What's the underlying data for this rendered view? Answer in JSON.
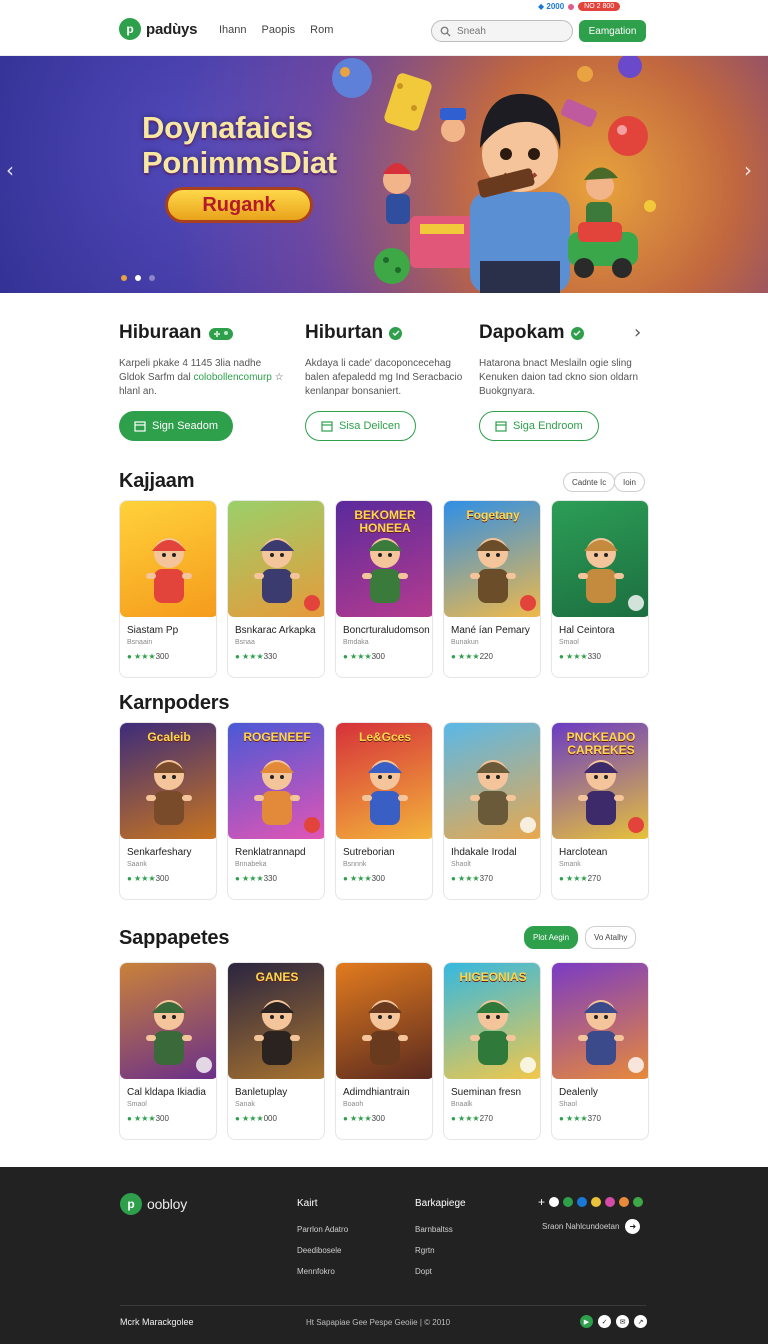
{
  "header": {
    "logo_mark": "p",
    "logo_text": "padùys",
    "nav": [
      "Ihann",
      "Paopis",
      "Rom"
    ],
    "search_placeholder": "Sneah",
    "cta": "Eamgation",
    "coin": "◆ 2000",
    "badge": "NO 2 800"
  },
  "hero": {
    "title_line1": "Doynafaicis",
    "title_line2": "PonimmsDiat",
    "cta": "Rugank",
    "prev": "‹",
    "next": "›"
  },
  "features": [
    {
      "title": "Hiburaan",
      "text_a": "Karpeli pkake 4 1145 3lia nadhe Gldok Sarfm dal ",
      "text_hl": "colobollencomurp",
      "text_b": " ☆ hlanl an.",
      "button": "Sign Seadom"
    },
    {
      "title": "Hiburtan",
      "text_a": "Akdaya li cade' dacoponcecehag balen afepaledd mg Ind Seracbacio kenlanpar bonsaniert.",
      "text_hl": "",
      "text_b": "",
      "button": "Sisa Deilcen"
    },
    {
      "title": "Dapokam",
      "text_a": "Hatarona bnact Meslailn ogie sling Kenuken daion tad ckno sion oldarn Buokgnyara.",
      "text_hl": "",
      "text_b": "",
      "button": "Siga Endroom"
    }
  ],
  "sections": [
    {
      "title": "Kajjaam",
      "chips": [
        "Cadnte Ic",
        "Ioin"
      ],
      "cards": [
        {
          "title": "Siastam Pp",
          "sub": "Bsnaain",
          "rating": "300",
          "overlay": "",
          "c1": "#ffd23a",
          "c2": "#f59b1c",
          "fig": "#e2443b",
          "corner": "none"
        },
        {
          "title": "Bsnkarac Arkapka",
          "sub": "Bsnaa",
          "rating": "330",
          "overlay": "",
          "c1": "#9ad06a",
          "c2": "#e79a3a",
          "fig": "#3b3b6f",
          "corner": "red"
        },
        {
          "title": "Boncrturaludomson",
          "sub": "Bmdaka",
          "rating": "300",
          "overlay": "BEKOMER HONEEA",
          "c1": "#5a2a9c",
          "c2": "#b53b8f",
          "fig": "#3a7a3a",
          "corner": "none"
        },
        {
          "title": "Mané ían Pemary",
          "sub": "Bunakun",
          "rating": "220",
          "overlay": "Fogetany",
          "c1": "#2f8fe6",
          "c2": "#f0b94a",
          "fig": "#6b4d2a",
          "corner": "red"
        },
        {
          "title": "Hal Ceintora",
          "sub": "Smaol",
          "rating": "330",
          "overlay": "",
          "c1": "#2c9e57",
          "c2": "#1c6e3f",
          "fig": "#c48a3e",
          "corner": "white"
        }
      ]
    },
    {
      "title": "Karnpoders",
      "chips": [],
      "cards": [
        {
          "title": "Senkarfeshary",
          "sub": "Saank",
          "rating": "300",
          "overlay": "Gcaleib",
          "c1": "#3d2c7a",
          "c2": "#c9751f",
          "fig": "#7a4b2a",
          "corner": "none"
        },
        {
          "title": "Renklatrannapd",
          "sub": "Bnnabeka",
          "rating": "330",
          "overlay": "ROGENEEF",
          "c1": "#4a58d6",
          "c2": "#e255b5",
          "fig": "#e28a3a",
          "corner": "red"
        },
        {
          "title": "Sutreborian",
          "sub": "Bsnnnk",
          "rating": "300",
          "overlay": "Le&Gces",
          "c1": "#d6313a",
          "c2": "#f3b43b",
          "fig": "#3a5fc4",
          "corner": "none"
        },
        {
          "title": "Ihdakale Irodal",
          "sub": "Shaolt",
          "rating": "370",
          "overlay": "",
          "c1": "#5ab8e8",
          "c2": "#e9a84d",
          "fig": "#6b5a3a",
          "corner": "white"
        },
        {
          "title": "Harclotean",
          "sub": "Smank",
          "rating": "270",
          "overlay": "PNCKEADO CARREKES",
          "c1": "#6a3bc4",
          "c2": "#e8c23a",
          "fig": "#3c2a6a",
          "corner": "red"
        }
      ]
    },
    {
      "title": "Sappapetes",
      "chips": [
        "Plot Aegin",
        "Vo Atalhy"
      ],
      "cards": [
        {
          "title": "Cal kldapa Ikiadia",
          "sub": "Smaol",
          "rating": "300",
          "overlay": "",
          "c1": "#c9823a",
          "c2": "#6a2f8a",
          "fig": "#3a6a3a",
          "corner": "white"
        },
        {
          "title": "Banletuplay",
          "sub": "Sanak",
          "rating": "000",
          "overlay": "GANES",
          "c1": "#2a2540",
          "c2": "#a8732f",
          "fig": "#2b2320",
          "corner": "none"
        },
        {
          "title": "Adimdhiantrain",
          "sub": "Boaoh",
          "rating": "300",
          "overlay": "",
          "c1": "#e27b1f",
          "c2": "#5a2a1f",
          "fig": "#6a3a1f",
          "corner": "none"
        },
        {
          "title": "Sueminan fresn",
          "sub": "Bnaalk",
          "rating": "270",
          "overlay": "HIGEONIAS",
          "c1": "#35b8e0",
          "c2": "#f2c84a",
          "fig": "#2f7a3a",
          "corner": "white"
        },
        {
          "title": "Dealenly",
          "sub": "Shaol",
          "rating": "370",
          "overlay": "",
          "c1": "#7a3bc4",
          "c2": "#e88a3a",
          "fig": "#3b4a8a",
          "corner": "white"
        }
      ]
    }
  ],
  "footer": {
    "logo_mark": "p",
    "logo_text": "oobloy",
    "col1": {
      "heading": "Kairt",
      "links": [
        "Parrlon Adatro",
        "Deedibosele",
        "Mennfokro"
      ]
    },
    "col2": {
      "heading": "Barkapiege",
      "links": [
        "Barnbaltss",
        "Rgrtn",
        "Dopt"
      ]
    },
    "newsletter": "Sraon Nahlcundoetan",
    "bottom_left": "Mcrk Marackgolee",
    "copyright": "Ht Sapapiae Gee Pespe Geoiie | © 2010"
  },
  "colors": {
    "accent": "#2e9f4b",
    "footer_bg": "#222222"
  }
}
